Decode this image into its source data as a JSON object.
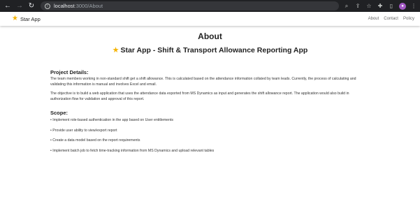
{
  "browser": {
    "url_host": "localhost",
    "url_path": ":3000/About"
  },
  "navbar": {
    "brand": "Star App",
    "links": [
      "About",
      "Contact",
      "Policy"
    ]
  },
  "page": {
    "title": "About",
    "app_title": "Star App - Shift & Transport Allowance Reporting App"
  },
  "project": {
    "heading": "Project Details:",
    "paragraphs": [
      "The team members working in non-standard shift get a shift allowance. This is calculated based on the attendance information collated by team leads. Currently, the process of calculating and validating this information is manual and involves Excel and email.",
      "The objective is to build a web application that uses the attendance data exported from MS Dynamics as input and generates the shift allowance report. The application would also build in authorization flow for validation and approval of this report."
    ]
  },
  "scope": {
    "heading": "Scope:",
    "items": [
      "• Implement role-based authentication in the app based on User entitlements",
      "• Provide user ability to view/export report",
      "• Create a data model based on the report requirements",
      "• Implement batch job to fetch time-tracking information from MS Dynamics and upload relevant tables"
    ]
  },
  "colors": {
    "chrome_bg": "#202124",
    "star": "#f5b301",
    "profile": "#a259c4"
  }
}
